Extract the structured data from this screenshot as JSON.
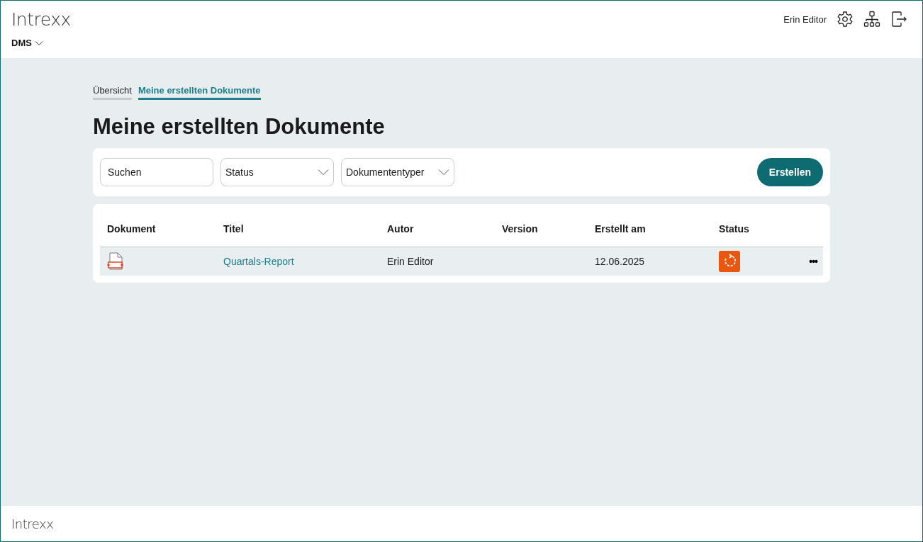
{
  "header": {
    "logo": "Intrexx",
    "app_menu": "DMS",
    "user": "Erin Editor"
  },
  "tabs": [
    {
      "label": "Übersicht",
      "selected": false
    },
    {
      "label": "Meine erstellten Dokumente",
      "selected": true
    }
  ],
  "page_title": "Meine erstellten Dokumente",
  "filters": {
    "search": {
      "placeholder": "Suchen"
    },
    "dropdowns": [
      "Status",
      "Dokumententyper"
    ],
    "create_button": "Erstellen"
  },
  "table": {
    "columns": [
      "Dokument",
      "Titel",
      "Autor",
      "Version",
      "Erstellt am",
      "Status"
    ],
    "rows": [
      {
        "title": "Quartals-Report",
        "author": "Erin Editor",
        "version": "",
        "created": "12.06.2025",
        "more": "•••"
      }
    ]
  },
  "footer": {
    "logo": "Intrexx"
  }
}
